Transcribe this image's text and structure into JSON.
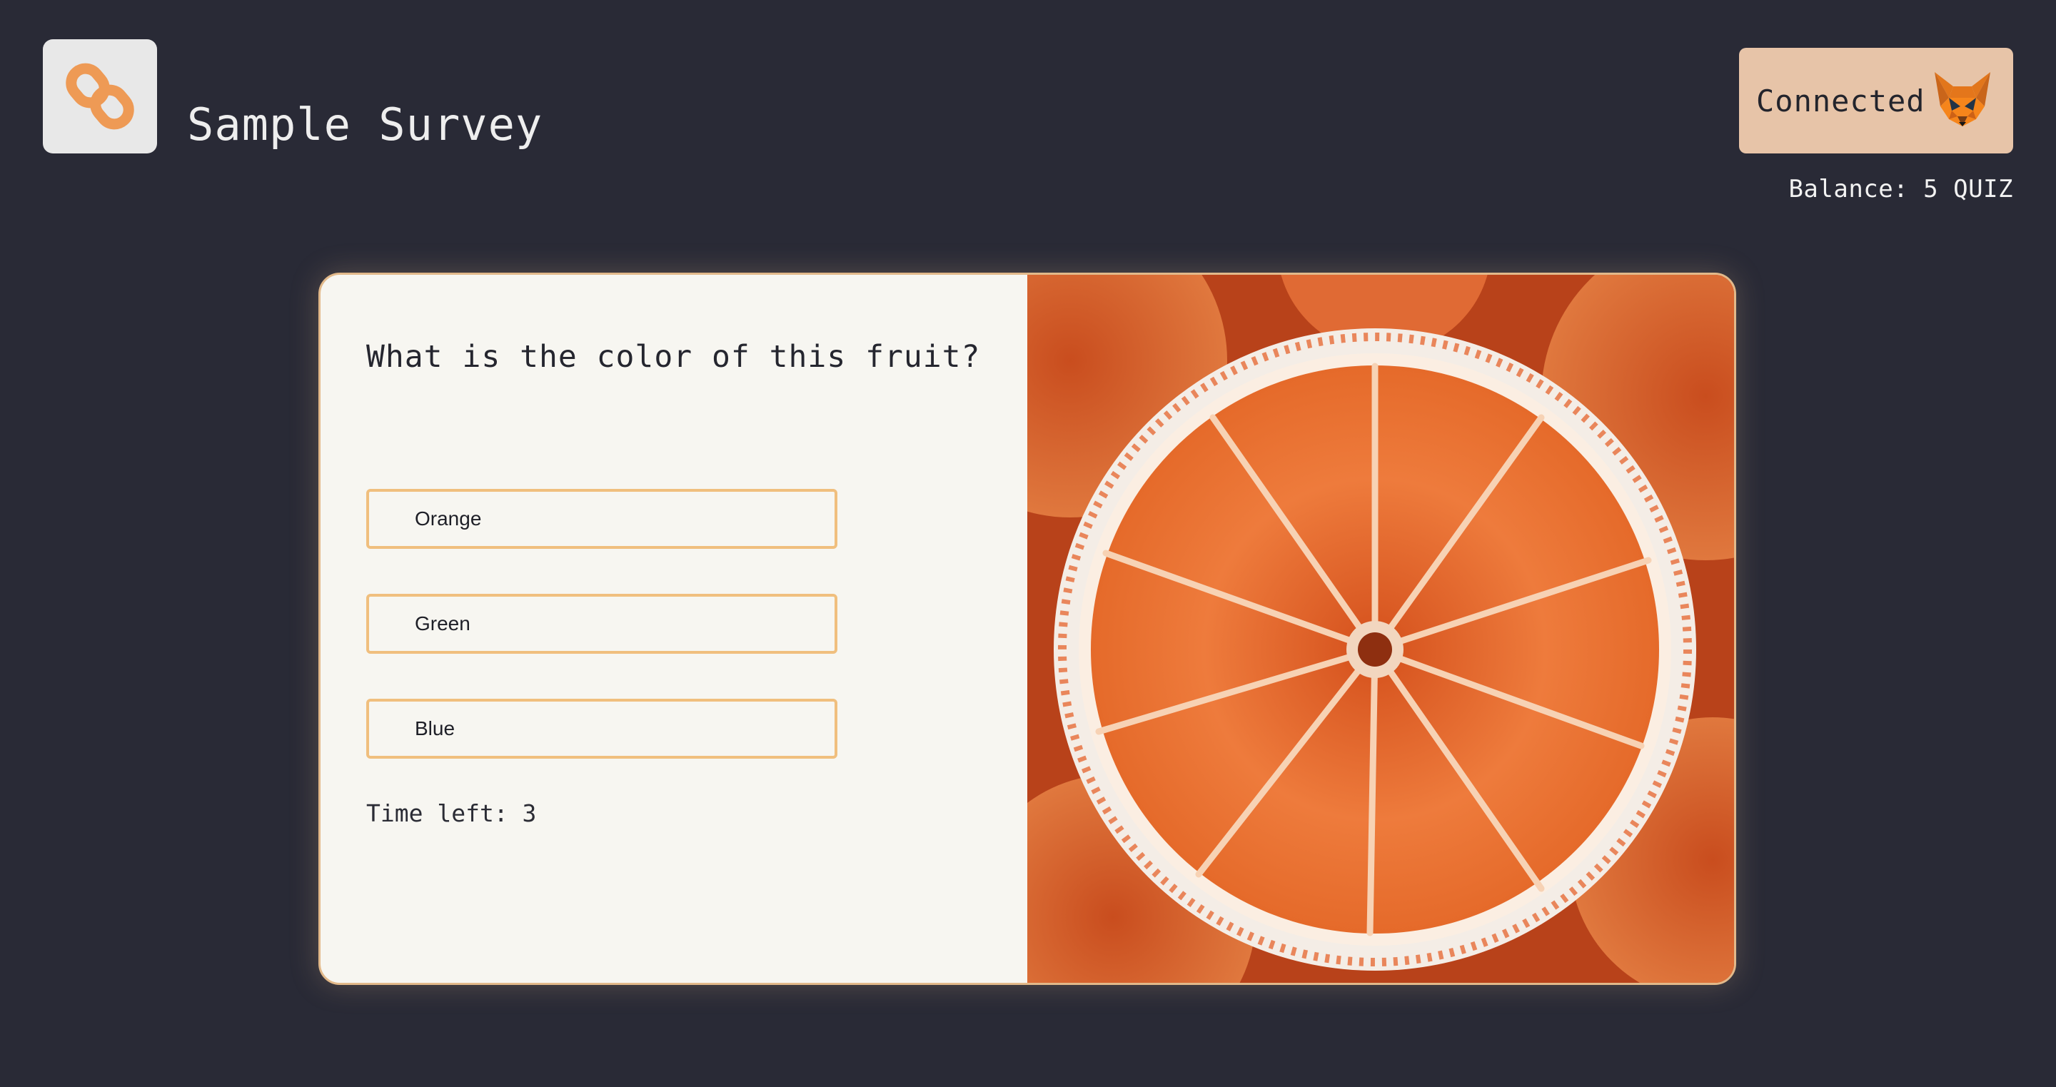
{
  "app": {
    "title": "Sample Survey",
    "logo_icon": "chain-link-icon"
  },
  "wallet": {
    "status_label": "Connected",
    "wallet_icon": "metamask-fox-icon",
    "balance_text": "Balance: 5 QUIZ"
  },
  "quiz": {
    "question": "What is the color of this fruit?",
    "options": [
      {
        "label": "Orange"
      },
      {
        "label": "Green"
      },
      {
        "label": "Blue"
      }
    ],
    "timer_text": "Time left: 3",
    "image_subject": "sliced-orange-image"
  },
  "colors": {
    "background": "#292a36",
    "accent": "#f0bf7e",
    "button": "#e7c4a8",
    "card": "#f7f6f1",
    "logo_icon": "#ee9a55"
  }
}
